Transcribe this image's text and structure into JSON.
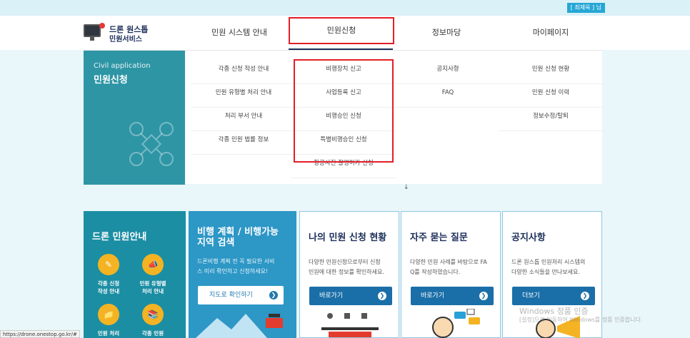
{
  "topbar": {
    "user_badge": "[ 최재욱 ] 님"
  },
  "logo": {
    "line1": "드론 원스톱",
    "line2": "민원서비스"
  },
  "nav": {
    "items": [
      {
        "label": "민원 시스템 안내"
      },
      {
        "label": "민원신청"
      },
      {
        "label": "정보마당"
      },
      {
        "label": "마이페이지"
      }
    ]
  },
  "dropdown": {
    "section_en": "Civil application",
    "section_ko": "민원신청",
    "columns": [
      [
        "각종 신청 작성 안내",
        "민원 유형별 처리 안내",
        "처리 부서 안내",
        "각종 민원 법률 정보"
      ],
      [
        "비행장치 신고",
        "사업등록 신고",
        "비행승인 신청",
        "특별비행승인 신청",
        "항공사진 촬영허가 신청"
      ],
      [
        "공지사항",
        "FAQ"
      ],
      [
        "민원 신청 현황",
        "민원 신청 이력",
        "정보수정/탈퇴"
      ]
    ]
  },
  "cards": {
    "guide": {
      "title": "드론 민원안내",
      "icons": [
        {
          "caption": "각종 신청\n작성 안내",
          "icon": "pencil-icon"
        },
        {
          "caption": "민원 유형별\n처리 안내",
          "icon": "megaphone-icon"
        },
        {
          "caption": "민원 처리",
          "icon": "folder-icon"
        },
        {
          "caption": "각종 민원",
          "icon": "books-icon"
        }
      ]
    },
    "flight": {
      "title": "비행 계획 / 비행가능\n지역 검색",
      "desc": "드론비행 계획 전 꼭 필요한 서비\n스 미리 확인하고 신청하세요!",
      "button": "지도로 확인하기"
    },
    "status": {
      "title": "나의 민원 신청 현황",
      "desc": "다양한 민원신청으로부터 신청\n민원에 대한 정보를 확인하세요.",
      "button": "바로가기"
    },
    "faq": {
      "title": "자주 묻는 질문",
      "desc": "다양한 민원 사례를 바탕으로 FA\nQ를 작성하였습니다.",
      "button": "바로가기"
    },
    "notice": {
      "title": "공지사항",
      "desc": "드론 원스톱 민원처리 시스템의\n다양한 소식들을 만나보세요.",
      "button": "더보기"
    }
  },
  "watermark": {
    "line1": "Windows 정품 인증",
    "line2": "[설정]으로 이동하여 Windows를 정품 인증합니다."
  },
  "status_bar": {
    "url": "https://drone.onestop.go.kr/#"
  },
  "colors": {
    "accent_red": "#e21f26",
    "navy": "#1b2e5a",
    "teal": "#2e95a5",
    "blue_btn": "#1b6fa8"
  }
}
